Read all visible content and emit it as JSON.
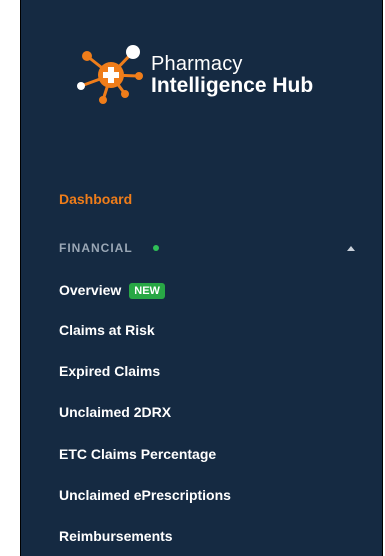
{
  "brand": {
    "line1": "Pharmacy",
    "line2": "Intelligence Hub",
    "accent_color": "#ef7d1a",
    "background_color": "#152a42"
  },
  "nav": {
    "dashboard_label": "Dashboard",
    "section": {
      "title": "FINANCIAL",
      "status_color": "#2fbf57",
      "expanded": true
    },
    "items": [
      {
        "label": "Overview",
        "badge": "NEW"
      },
      {
        "label": "Claims at Risk"
      },
      {
        "label": "Expired Claims"
      },
      {
        "label": "Unclaimed 2DRX"
      },
      {
        "label": "ETC Claims Percentage"
      },
      {
        "label": "Unclaimed ePrescriptions"
      },
      {
        "label": "Reimbursements"
      }
    ]
  }
}
